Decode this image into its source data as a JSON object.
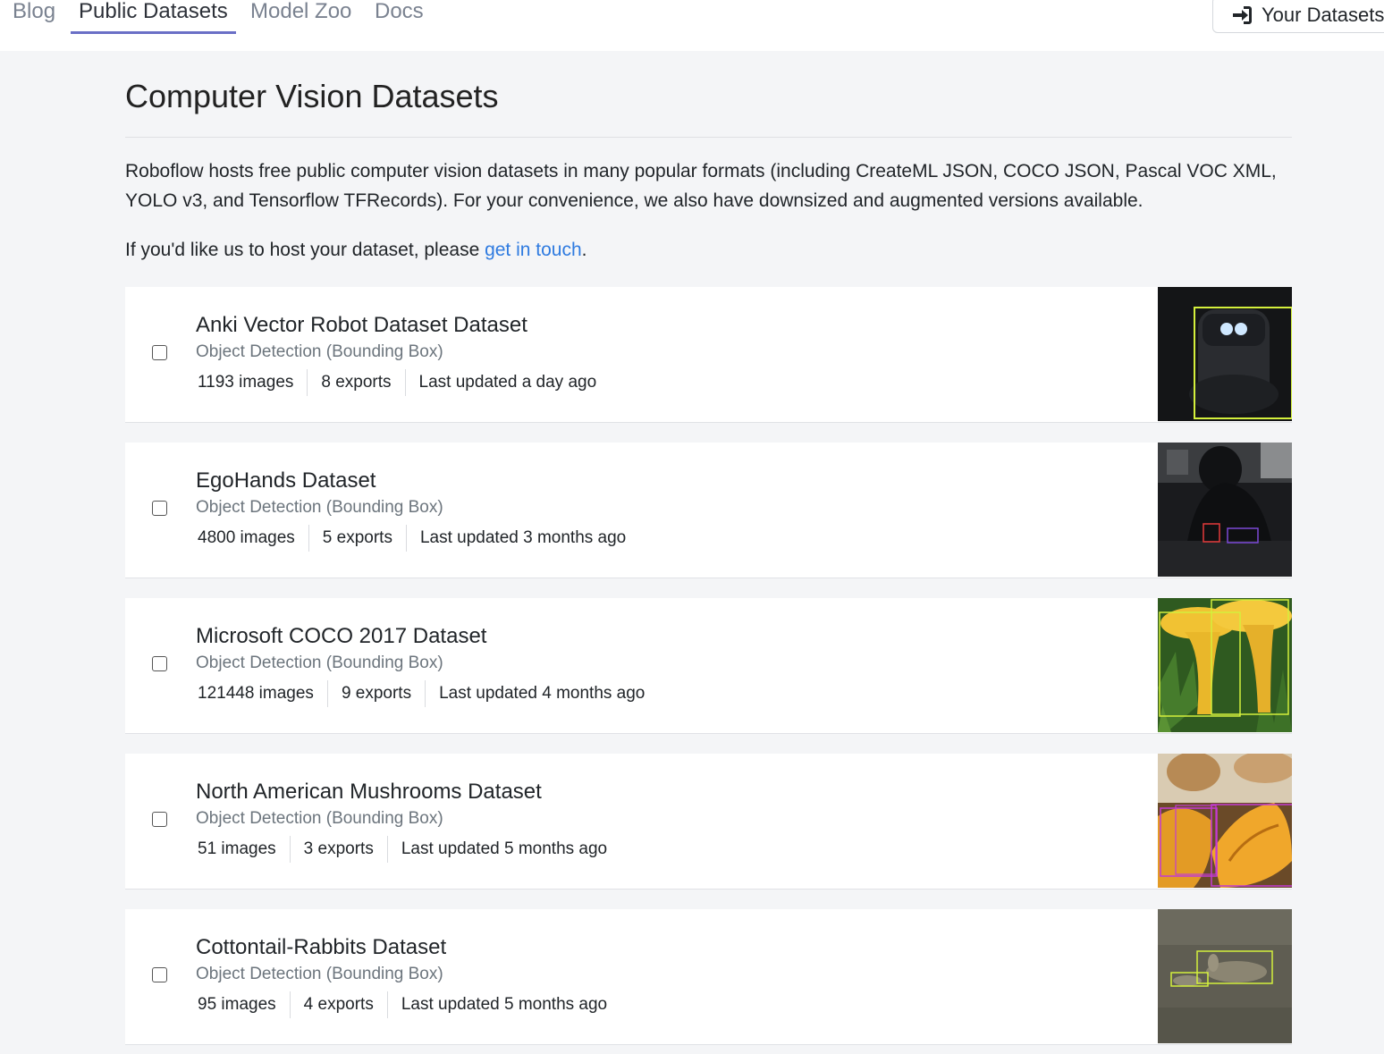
{
  "nav": {
    "tabs": [
      {
        "label": "Blog",
        "active": false
      },
      {
        "label": "Public Datasets",
        "active": true
      },
      {
        "label": "Model Zoo",
        "active": false
      },
      {
        "label": "Docs",
        "active": false
      }
    ],
    "your_datasets_label": "Your Datasets",
    "your_datasets_icon": "sign-in-icon"
  },
  "page": {
    "title": "Computer Vision Datasets",
    "intro": "Roboflow hosts free public computer vision datasets in many popular formats (including CreateML JSON, COCO JSON, Pascal VOC XML, YOLO v3, and Tensorflow TFRecords). For your convenience, we also have downsized and augmented versions available.",
    "host_text": "If you'd like us to host your dataset, please ",
    "host_link": "get in touch",
    "host_end": "."
  },
  "datasets": [
    {
      "title": "Anki Vector Robot Dataset Dataset",
      "type": "Object Detection (Bounding Box)",
      "images": "1193 images",
      "exports": "8 exports",
      "updated": "Last updated a day ago"
    },
    {
      "title": "EgoHands Dataset",
      "type": "Object Detection (Bounding Box)",
      "images": "4800 images",
      "exports": "5 exports",
      "updated": "Last updated 3 months ago"
    },
    {
      "title": "Microsoft COCO 2017 Dataset",
      "type": "Object Detection (Bounding Box)",
      "images": "121448 images",
      "exports": "9 exports",
      "updated": "Last updated 4 months ago"
    },
    {
      "title": "North American Mushrooms Dataset",
      "type": "Object Detection (Bounding Box)",
      "images": "51 images",
      "exports": "3 exports",
      "updated": "Last updated 5 months ago"
    },
    {
      "title": "Cottontail-Rabbits Dataset",
      "type": "Object Detection (Bounding Box)",
      "images": "95 images",
      "exports": "4 exports",
      "updated": "Last updated 5 months ago"
    }
  ],
  "colors": {
    "accent_underline": "#6a6fc6",
    "link": "#2f7be0",
    "bbox_green": "#d4f03c",
    "bbox_magenta": "#c33bd3"
  }
}
